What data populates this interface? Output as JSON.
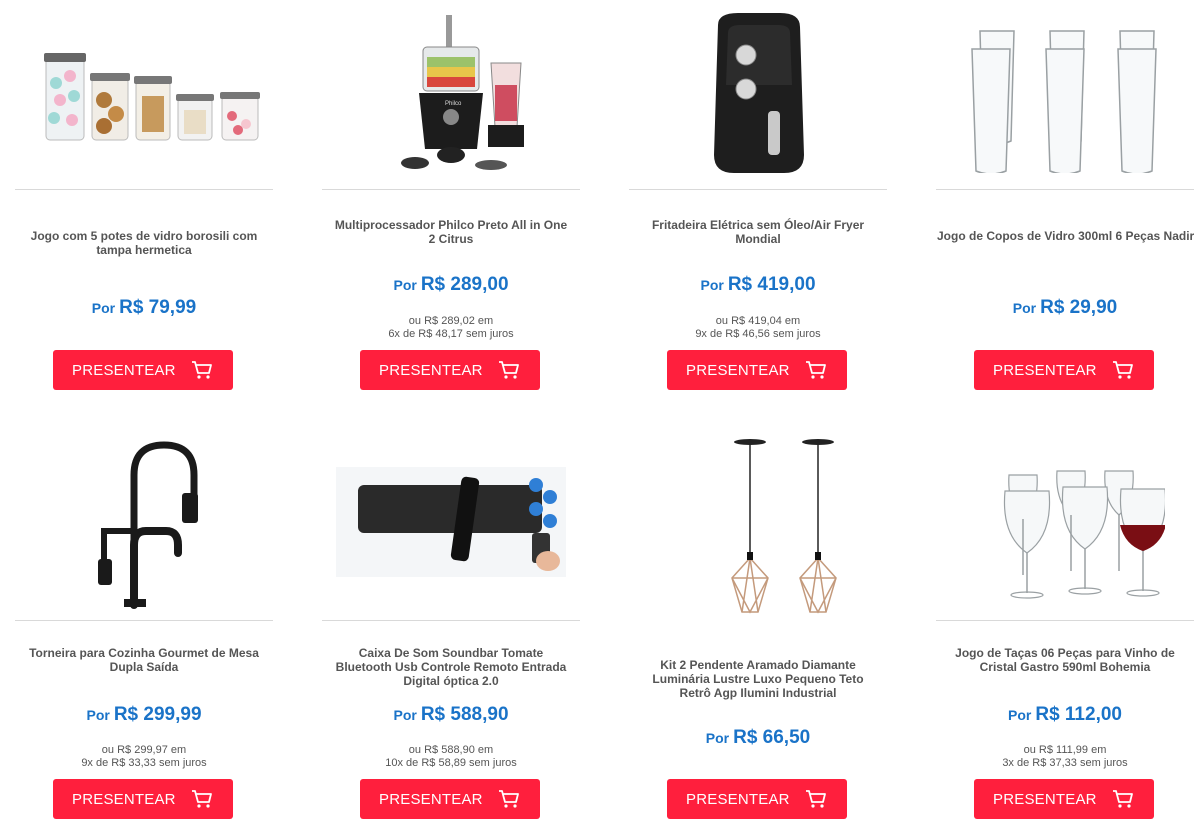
{
  "products": [
    {
      "title": "Jogo com 5 potes de vidro borosili com tampa hermetica",
      "por": "Por",
      "price": "R$ 79,99",
      "inst1": "",
      "inst2": "",
      "button": "PRESENTEAR"
    },
    {
      "title": "Multiprocessador Philco Preto All in One 2 Citrus",
      "por": "Por",
      "price": "R$ 289,00",
      "inst1": "ou R$ 289,02 em",
      "inst2": "6x de R$ 48,17 sem juros",
      "button": "PRESENTEAR",
      "brand": "Philco"
    },
    {
      "title": "Fritadeira Elétrica sem Óleo/Air Fryer Mondial",
      "por": "Por",
      "price": "R$ 419,00",
      "inst1": "ou R$ 419,04 em",
      "inst2": "9x de R$ 46,56 sem juros",
      "button": "PRESENTEAR"
    },
    {
      "title": "Jogo de Copos de Vidro 300ml 6 Peças Nadir",
      "por": "Por",
      "price": "R$ 29,90",
      "inst1": "",
      "inst2": "",
      "button": "PRESENTEAR"
    },
    {
      "title": "Torneira para Cozinha Gourmet de Mesa Dupla Saída",
      "por": "Por",
      "price": "R$ 299,99",
      "inst1": "ou R$ 299,97 em",
      "inst2": "9x de R$ 33,33 sem juros",
      "button": "PRESENTEAR"
    },
    {
      "title": "Caixa De Som Soundbar Tomate Bluetooth Usb Controle Remoto Entrada Digital óptica 2.0",
      "por": "Por",
      "price": "R$ 588,90",
      "inst1": "ou R$ 588,90 em",
      "inst2": "10x de R$ 58,89 sem juros",
      "button": "PRESENTEAR"
    },
    {
      "title": "Kit 2 Pendente Aramado Diamante Luminária Lustre Luxo Pequeno Teto Retrô Agp Ilumini Industrial",
      "por": "Por",
      "price": "R$ 66,50",
      "inst1": "",
      "inst2": "",
      "button": "PRESENTEAR"
    },
    {
      "title": "Jogo de Taças 06 Peças para Vinho de Cristal Gastro 590ml Bohemia",
      "por": "Por",
      "price": "R$ 112,00",
      "inst1": "ou R$ 111,99 em",
      "inst2": "3x de R$ 37,33 sem juros",
      "button": "PRESENTEAR"
    }
  ],
  "colors": {
    "button": "#ff1f3d",
    "price": "#1a73c8"
  },
  "icons": {
    "cart": "shopping-cart-icon"
  }
}
